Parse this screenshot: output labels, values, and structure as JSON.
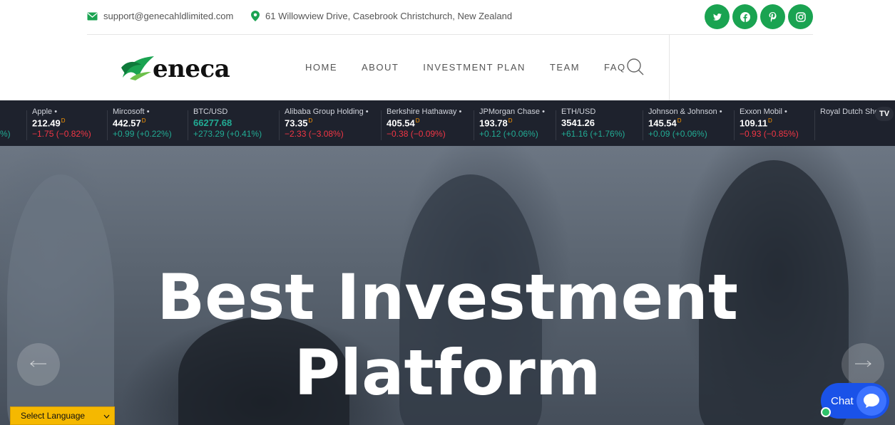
{
  "topbar": {
    "email": "support@genecahldlimited.com",
    "address": "61 Willowview Drive, Casebrook Christchurch, New Zealand",
    "social_icons": [
      "twitter-icon",
      "facebook-icon",
      "pinterest-icon",
      "instagram-icon"
    ]
  },
  "brand": {
    "name": "Geneca",
    "logo_text": "eneca",
    "accent": "#1aa351"
  },
  "nav": {
    "items": [
      "HOME",
      "ABOUT",
      "INVESTMENT PLAN",
      "TEAM",
      "FAQ"
    ]
  },
  "ticker": {
    "lead_fragment": "%)",
    "items": [
      {
        "name": "Apple",
        "dot": "•",
        "price": "212.49",
        "flag": "D",
        "change": "−1.75 (−0.82%)",
        "dir": "down"
      },
      {
        "name": "Mircosoft",
        "dot": "•",
        "price": "442.57",
        "flag": "D",
        "change": "+0.99 (+0.22%)",
        "dir": "up"
      },
      {
        "name": "BTC/USD",
        "dot": "",
        "price": "66277.68",
        "flag": "",
        "change": "+273.29 (+0.41%)",
        "dir": "up",
        "price_green": true
      },
      {
        "name": "Alibaba Group Holding",
        "dot": "•",
        "price": "73.35",
        "flag": "D",
        "change": "−2.33 (−3.08%)",
        "dir": "down"
      },
      {
        "name": "Berkshire Hathaway",
        "dot": "•",
        "price": "405.54",
        "flag": "D",
        "change": "−0.38 (−0.09%)",
        "dir": "down"
      },
      {
        "name": "JPMorgan Chase",
        "dot": "•",
        "price": "193.78",
        "flag": "D",
        "change": "+0.12 (+0.06%)",
        "dir": "up"
      },
      {
        "name": "ETH/USD",
        "dot": "",
        "price": "3541.26",
        "flag": "",
        "change": "+61.16 (+1.76%)",
        "dir": "up"
      },
      {
        "name": "Johnson & Johnson",
        "dot": "•",
        "price": "145.54",
        "flag": "D",
        "change": "+0.09 (+0.06%)",
        "dir": "up"
      },
      {
        "name": "Exxon Mobil",
        "dot": "•",
        "price": "109.11",
        "flag": "D",
        "change": "−0.93 (−0.85%)",
        "dir": "down"
      },
      {
        "name": "Royal Dutch She",
        "dot": "",
        "price": "",
        "flag": "",
        "change": "",
        "dir": ""
      }
    ],
    "badge": "TV"
  },
  "hero": {
    "line1": "Best Investment",
    "line2": "Platform"
  },
  "language": {
    "selected": "Select Language"
  },
  "chat": {
    "label": "Chat"
  }
}
